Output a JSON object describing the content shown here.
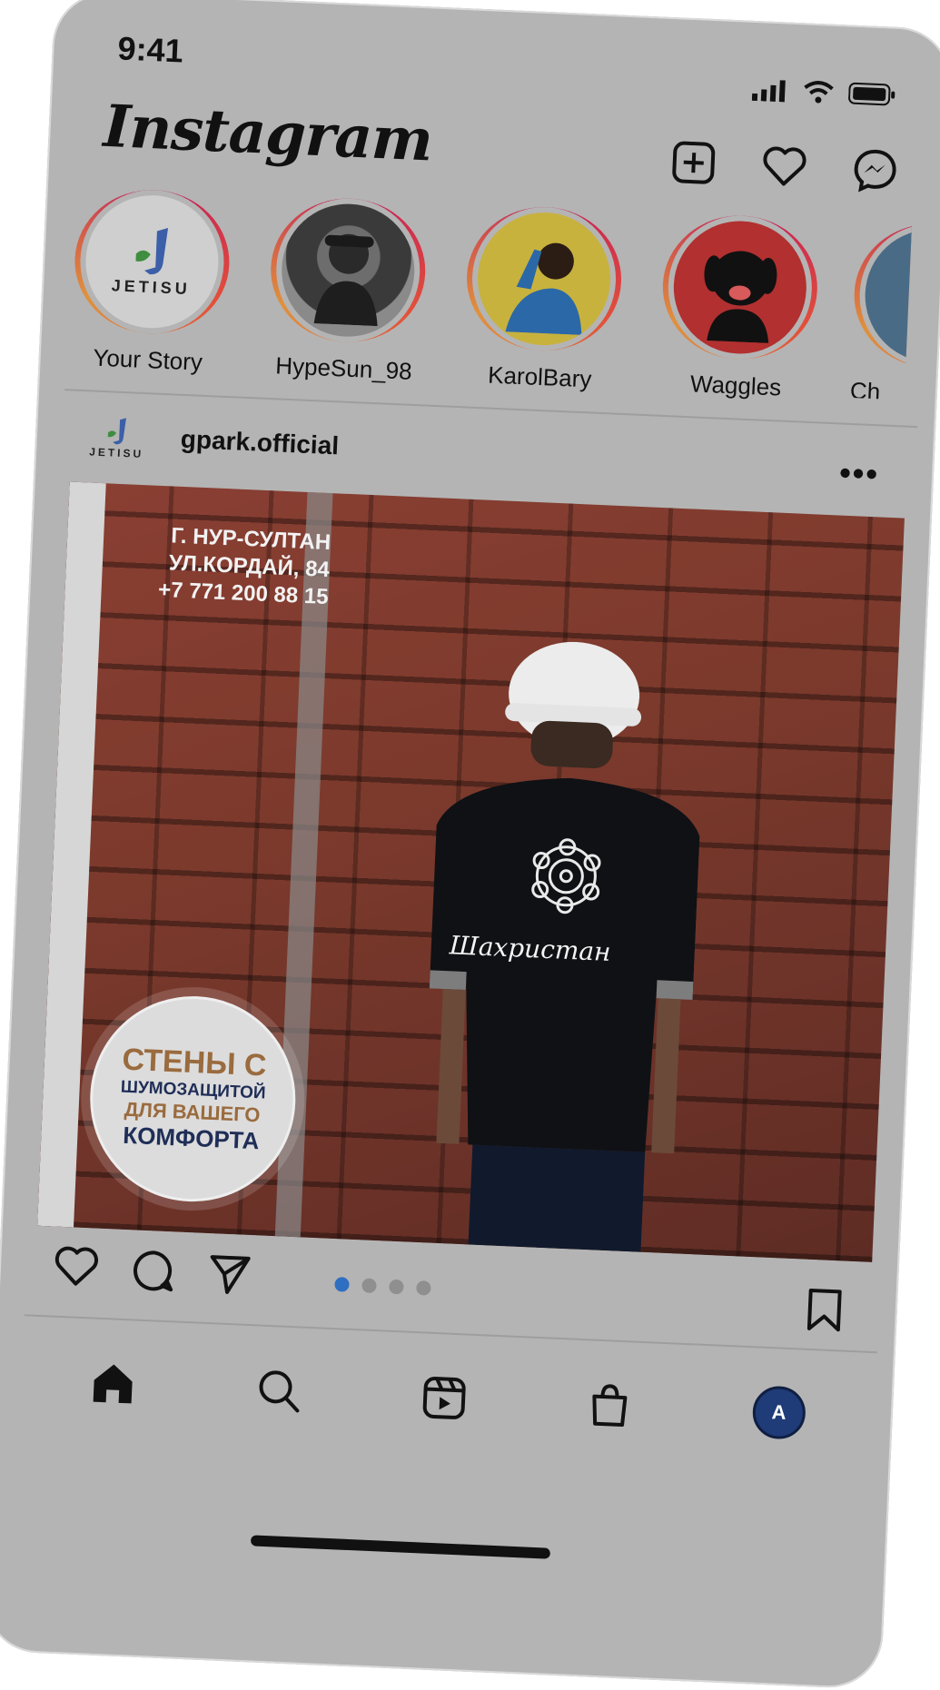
{
  "status": {
    "time": "9:41"
  },
  "app": {
    "logo": "Instagram"
  },
  "stories": [
    {
      "label": "Your Story",
      "avatar_text": "JETISU"
    },
    {
      "label": "HypeSun_98"
    },
    {
      "label": "KarolBary"
    },
    {
      "label": "Waggles"
    },
    {
      "label": "Ch"
    }
  ],
  "post": {
    "username": "gpark.official",
    "avatar_text": "JETISU",
    "more": "•••",
    "address_lines": [
      "Г. НУР-СУЛТАН",
      "УЛ.КОРДАЙ, 84",
      "+7 771 200 88 15"
    ],
    "badge_lines": [
      "СТЕНЫ С",
      "ШУМОЗАЩИТОЙ",
      "ДЛЯ ВАШЕГО",
      "КОМФОРТА"
    ],
    "shirt_text": "Шахристан",
    "carousel": {
      "count": 4,
      "active": 1
    }
  },
  "tabbar": {
    "profile_letter": "A"
  },
  "colors": {
    "accent": "#2f6fc1",
    "ring_start": "#c2185b",
    "ring_end": "#e0913c"
  },
  "icons": {
    "top_actions": [
      "plus-square-icon",
      "heart-icon",
      "messenger-icon"
    ],
    "post_actions": [
      "heart-icon",
      "comment-icon",
      "send-icon",
      "bookmark-icon"
    ],
    "tabbar": [
      "home-icon",
      "search-icon",
      "reels-icon",
      "shop-icon",
      "profile-avatar"
    ]
  }
}
